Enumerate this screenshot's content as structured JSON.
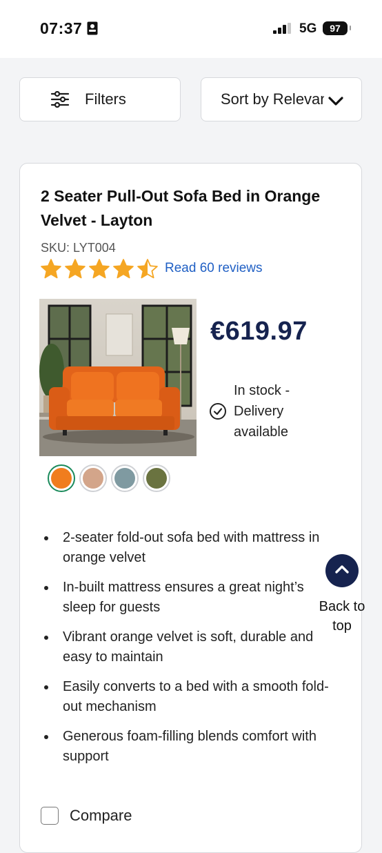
{
  "status_bar": {
    "time": "07:37",
    "network": "5G",
    "battery": "97"
  },
  "toolbar": {
    "filters_label": "Filters",
    "sort_label": "Sort by Relevance"
  },
  "product": {
    "title": "2 Seater Pull-Out Sofa Bed in Orange Velvet - Layton",
    "sku": "SKU: LYT004",
    "rating": 4.5,
    "rating_max": 5,
    "reviews_link": "Read 60 reviews",
    "price": "€619.97",
    "stock": "In stock - Delivery available",
    "swatches": [
      "#f07d1e",
      "#d3a58a",
      "#7f9aa1",
      "#6a7340"
    ],
    "features": [
      "2-seater fold-out sofa bed with mattress in orange velvet",
      "In-built mattress ensures a great night’s sleep for guests",
      "Vibrant orange velvet is soft, durable and easy to maintain",
      "Easily converts to a bed with a smooth fold-out mechanism",
      "Generous foam-filling blends comfort with support"
    ],
    "compare_label": "Compare"
  },
  "back_to_top": "Back to top",
  "colors": {
    "navy": "#16234f",
    "star": "#f5a623",
    "link": "#1f5fc4"
  }
}
